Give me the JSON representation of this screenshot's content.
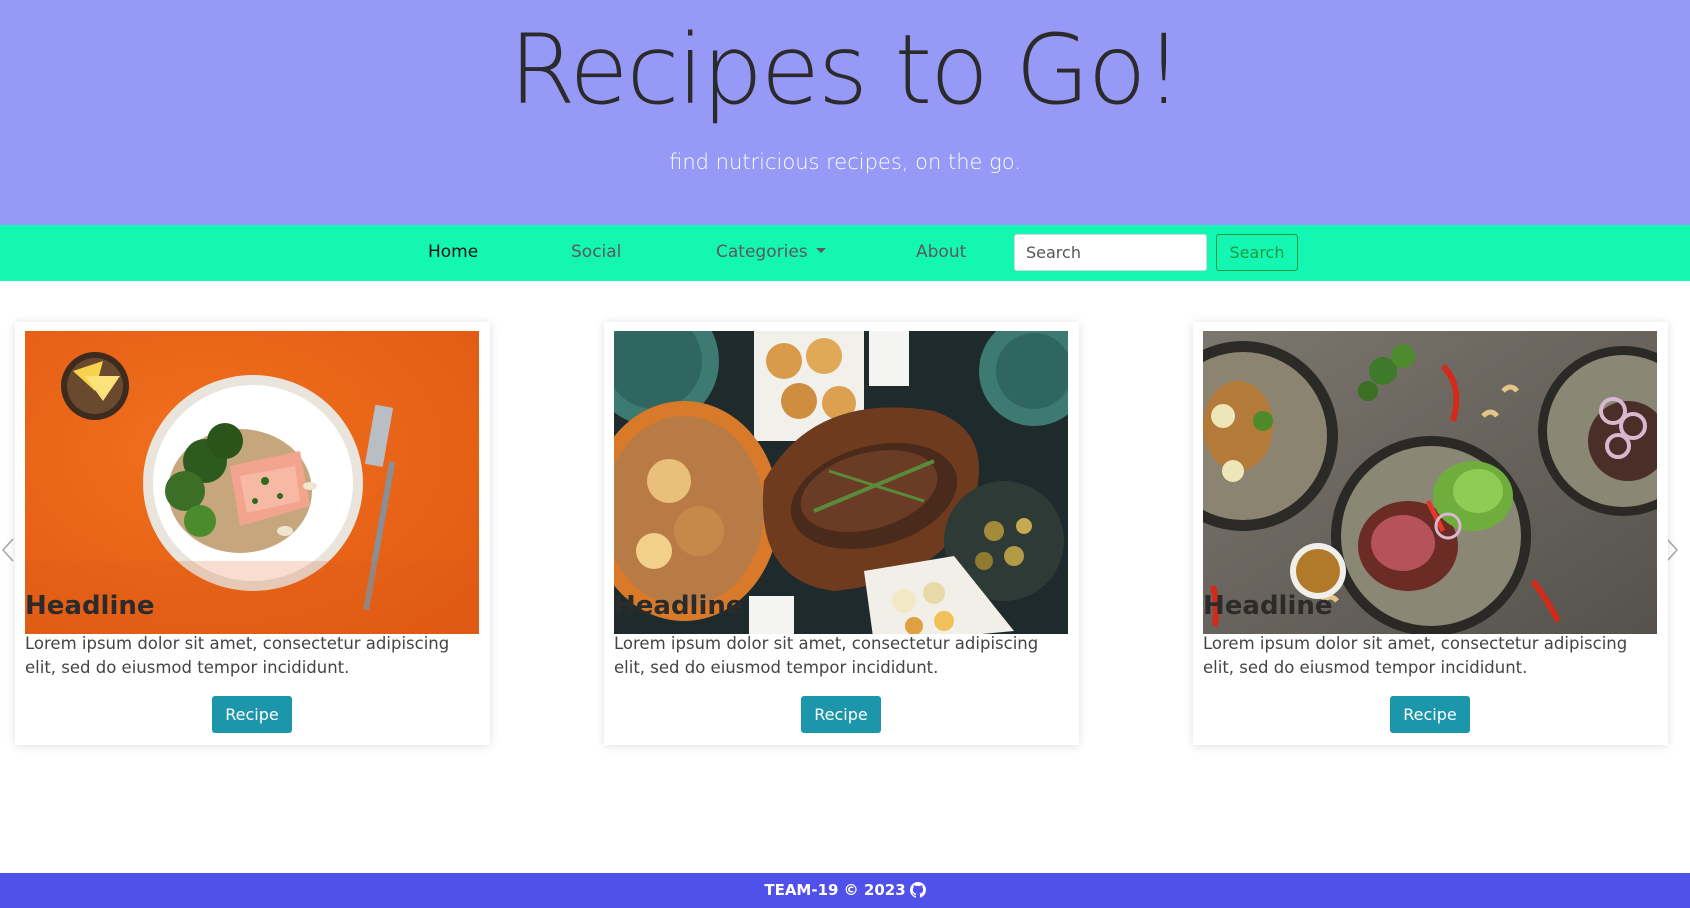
{
  "hero": {
    "title": "Recipes to Go!",
    "subtitle": "find nutricious recipes, on the go."
  },
  "nav": {
    "home": "Home",
    "social": "Social",
    "categories": "Categories",
    "about": "About",
    "search_placeholder": "Search",
    "search_button": "Search"
  },
  "cards": [
    {
      "headline": "Headline",
      "text": "Lorem ipsum dolor sit amet, consectetur adipiscing elit, sed do eiusmod tempor incididunt.",
      "button": "Recipe",
      "image_subject": "salmon-plate"
    },
    {
      "headline": "Headline",
      "text": "Lorem ipsum dolor sit amet, consectetur adipiscing elit, sed do eiusmod tempor incididunt.",
      "button": "Recipe",
      "image_subject": "roast-feast"
    },
    {
      "headline": "Headline",
      "text": "Lorem ipsum dolor sit amet, consectetur adipiscing elit, sed do eiusmod tempor incididunt.",
      "button": "Recipe",
      "image_subject": "steak-bowls"
    }
  ],
  "footer": {
    "text": "TEAM-19 © 2023"
  },
  "icons": {
    "carousel_prev": "chevron-left-icon",
    "carousel_next": "chevron-right-icon",
    "footer": "github-icon"
  },
  "colors": {
    "hero_bg": "#9699f5",
    "navbar_bg": "#14f7b3",
    "button_bg": "#1b96ab",
    "search_outline": "#1f9b3f",
    "footer_bg": "#4f51ea"
  }
}
